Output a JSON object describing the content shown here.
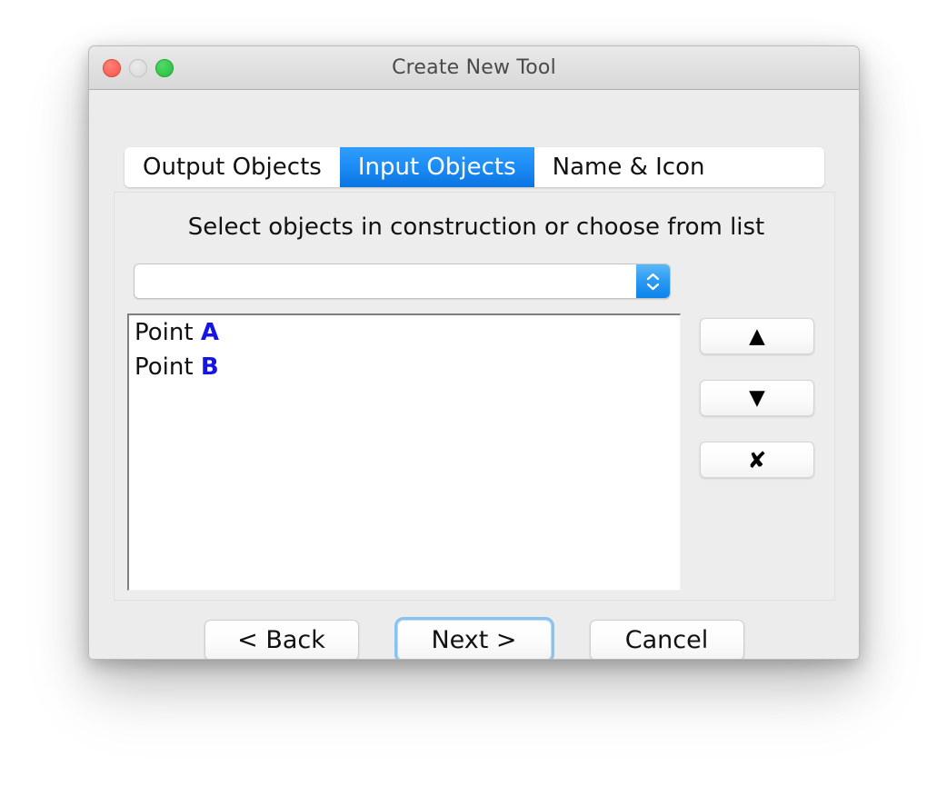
{
  "window": {
    "title": "Create New Tool",
    "controls": {
      "close": "close-button",
      "minimize": "minimize-button",
      "maximize": "maximize-button"
    },
    "colors": {
      "close": "#f85549",
      "minimize": "#d9d9d9",
      "maximize": "#1fbf3a",
      "accent": "#1e8ef6",
      "object_label": "#1414e6",
      "focus_ring": "#88c4ef",
      "window_background": "#ececec",
      "panel_background": "#ededed"
    }
  },
  "tabs": [
    {
      "label": "Output Objects",
      "active": false
    },
    {
      "label": "Input Objects",
      "active": true
    },
    {
      "label": "Name & Icon",
      "active": false
    }
  ],
  "content": {
    "instruction": "Select objects in construction or choose from list",
    "combo": {
      "value": "",
      "placeholder": "",
      "stepper_icon": "chevron-up-down-icon"
    },
    "list": {
      "items": [
        {
          "prefix": "Point ",
          "label": "A"
        },
        {
          "prefix": "Point ",
          "label": "B"
        }
      ]
    },
    "side_buttons": [
      {
        "name": "move-up-button",
        "glyph": "▲"
      },
      {
        "name": "move-down-button",
        "glyph": "▼"
      },
      {
        "name": "remove-button",
        "glyph": "✘"
      }
    ]
  },
  "footer": {
    "back": "< Back",
    "next": "Next >",
    "cancel": "Cancel"
  }
}
